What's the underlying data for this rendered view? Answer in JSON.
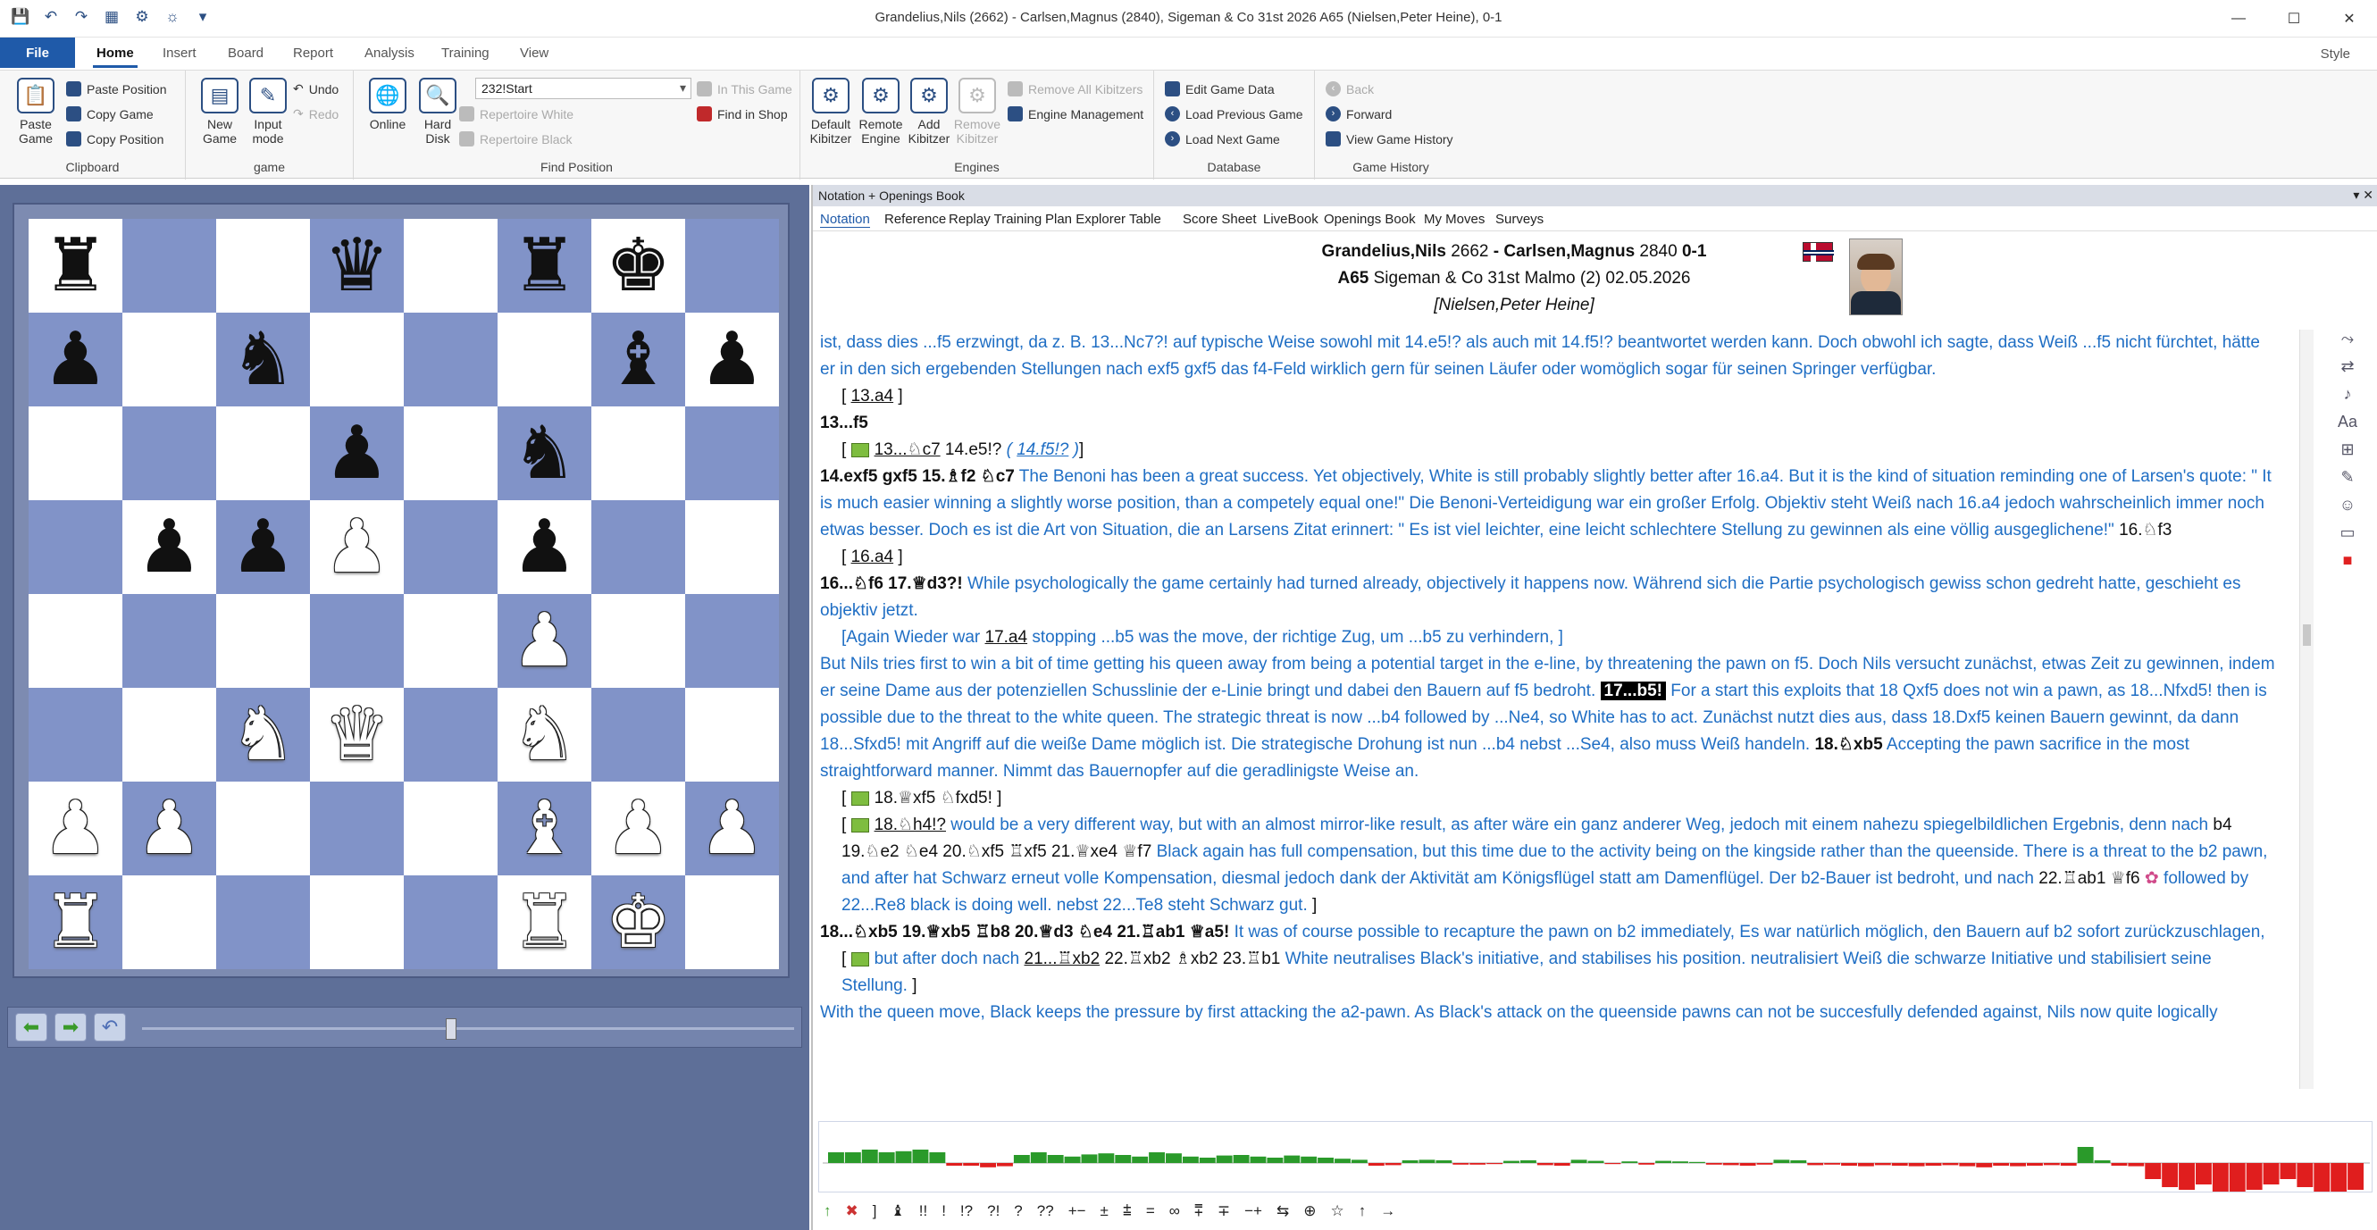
{
  "window": {
    "title": "Grandelius,Nils (2662) - Carlsen,Magnus (2840), Sigeman & Co 31st 2026  A65  (Nielsen,Peter Heine), 0-1",
    "minimize": "—",
    "maximize": "☐",
    "close": "✕"
  },
  "ribbon_tabs": {
    "file": "File",
    "home": "Home",
    "insert": "Insert",
    "board": "Board",
    "report": "Report",
    "analysis": "Analysis",
    "training": "Training",
    "view": "View",
    "style": "Style"
  },
  "ribbon": {
    "clipboard": {
      "label": "Clipboard",
      "paste_game": "Paste Game",
      "paste_position": "Paste Position",
      "copy_game": "Copy Game",
      "copy_position": "Copy Position"
    },
    "game": {
      "label": "game",
      "new_game": "New Game",
      "input_mode": "Input mode",
      "undo": "Undo",
      "redo": "Redo"
    },
    "find_position": {
      "label": "Find Position",
      "online": "Online",
      "hard_disk": "Hard Disk",
      "combo_value": "232!Start",
      "repertoire_white": "Repertoire White",
      "repertoire_black": "Repertoire Black",
      "in_this_game": "In This Game",
      "find_in_shop": "Find in Shop"
    },
    "engines": {
      "label": "Engines",
      "default_kibitzer": "Default Kibitzer",
      "remote_engine": "Remote Engine",
      "add_kibitzer": "Add Kibitzer",
      "remove_kibitzer": "Remove Kibitzer",
      "remove_all": "Remove All Kibitzers",
      "engine_management": "Engine Management"
    },
    "database": {
      "label": "Database",
      "edit_game_data": "Edit Game Data",
      "load_previous": "Load Previous Game",
      "load_next": "Load Next Game"
    },
    "history": {
      "label": "Game History",
      "back": "Back",
      "forward": "Forward",
      "view_history": "View Game History"
    }
  },
  "board": {
    "ranks": [
      [
        "r",
        "",
        "",
        "q",
        "",
        "r",
        "k",
        ""
      ],
      [
        "p",
        "",
        "n",
        "",
        "",
        "",
        "b",
        "p"
      ],
      [
        "",
        "",
        "",
        "p",
        "",
        "n",
        "",
        ""
      ],
      [
        "",
        "p",
        "p",
        "P",
        "",
        "p",
        "",
        ""
      ],
      [
        "",
        "",
        "",
        "",
        "",
        "P",
        "",
        ""
      ],
      [
        "",
        "",
        "N",
        "Q",
        "",
        "N",
        "",
        ""
      ],
      [
        "P",
        "P",
        "",
        "",
        "",
        "B",
        "P",
        "P"
      ],
      [
        "R",
        "",
        "",
        "",
        "",
        "R",
        "K",
        ""
      ]
    ]
  },
  "notation": {
    "pane_title": "Notation + Openings Book",
    "tabs": [
      "Notation",
      "Reference",
      "Replay Training",
      "Plan Explorer",
      "Table",
      "Score Sheet",
      "LiveBook",
      "Openings Book",
      "My Moves",
      "Surveys"
    ],
    "header": {
      "white": "Grandelius,Nils",
      "white_elo": "2662",
      "black": "Carlsen,Magnus",
      "black_elo": "2840",
      "result": "0-1",
      "eco": "A65",
      "event": "Sigeman & Co 31st Malmo (2)",
      "date": "02.05.2026",
      "annotator": "[Nielsen,Peter Heine]"
    }
  },
  "text": {
    "p1": "ist, dass dies ...f5 erzwingt, da z. B. 13...Nc7?! auf typische Weise sowohl mit 14.e5!? als auch mit 14.f5!? beantwortet werden kann. Doch obwohl ich sagte, dass Weiß ...f5 nicht fürchtet, hätte er in den sich ergebenden Stellungen nach exf5 gxf5 das f4-Feld wirklich gern für seinen Läufer oder womöglich sogar für seinen Springer verfügbar.",
    "p2": "13.a4",
    "p3": "13...f5",
    "p4a": "13...♘c7",
    "p4b": "14.e5!?",
    "p4c": "14.f5!?",
    "p5a": "14.exf5  gxf5  15.♗f2  ♘c7",
    "p5b": "The Benoni has been a great success. Yet objectively, White is still probably slightly better after 16.a4. But it is the kind of situation reminding one of Larsen's quote: \" It is much easier winning a slightly worse position, than a competely equal one!\" Die Benoni-Verteidigung war ein großer Erfolg. Objektiv steht Weiß nach 16.a4 jedoch wahrscheinlich immer noch etwas besser. Doch es ist die Art von Situation, die an Larsens Zitat erinnert: \" Es ist viel leichter, eine leicht schlechtere Stellung zu gewinnen als eine völlig ausgeglichene!\"",
    "p5c": "16.♘f3",
    "p6": "16.a4",
    "p7a": "16...♘f6  17.♕d3?!",
    "p7b": "While psychologically the game certainly had turned already, objectively it happens now. Während sich die Partie psychologisch gewiss schon gedreht hatte, geschieht es objektiv jetzt.",
    "p8a": "Again Wieder war",
    "p8b": "17.a4",
    "p8c": "stopping ...b5 was the move, der richtige Zug, um ...b5 zu verhindern,",
    "p9a": "But Nils tries first to win a bit of time getting his queen away from being a potential target in the e-line, by threatening the pawn on f5.  Doch Nils versucht zunächst, etwas Zeit zu gewinnen, indem er seine Dame aus der potenziellen Schusslinie der e-Linie bringt und dabei den Bauern auf f5 bedroht.",
    "p9b": "17...b5!",
    "p9c": "For a start this exploits that 18 Qxf5 does not win a pawn, as 18...Nfxd5! then is possible due to the threat to the white queen. The strategic threat is now ...b4 followed by ...Ne4, so White has to act. Zunächst nutzt dies aus, dass 18.Dxf5 keinen Bauern gewinnt, da dann 18...Sfxd5! mit Angriff auf die weiße Dame möglich ist. Die strategische Drohung ist nun ...b4 nebst ...Se4, also muss Weiß handeln.",
    "p9d": "18.♘xb5",
    "p9e": "Accepting the pawn sacrifice in the most straightforward manner. Nimmt das Bauernopfer auf die geradlinigste Weise an.",
    "p10": "18.♕xf5  ♘fxd5!",
    "p11a": "18.♘h4!?",
    "p11b": "would be a very different way, but with an almost mirror-like result, as after wäre ein ganz anderer Weg, jedoch mit einem nahezu spiegelbildlichen Ergebnis, denn nach",
    "p11c": "b4  19.♘e2  ♘e4  20.♘xf5  ♖xf5  21.♕xe4  ♕f7",
    "p11d": "Black again has full compensation, but this time due to the activity being on the kingside rather than the queenside. There is a threat to the b2 pawn, and after hat Schwarz erneut volle Kompensation, diesmal jedoch dank der Aktivität am Königsflügel statt am Damenflügel. Der b2-Bauer ist bedroht, und nach",
    "p11e": "22.♖ab1 ♕f6",
    "p11f": "followed by 22...Re8 black is doing well. nebst 22...Te8 steht Schwarz gut.",
    "p12a": "18...♘xb5  19.♕xb5  ♖b8  20.♕d3  ♘e4  21.♖ab1  ♕a5!",
    "p12b": "It was of course possible to recapture the pawn on b2 immediately, Es war natürlich möglich, den Bauern auf b2 sofort zurückzuschlagen,",
    "p13a": "but after doch nach",
    "p13b": "21...♖xb2",
    "p13c": "22.♖xb2  ♗xb2  23.♖b1",
    "p13d": "White neutralises Black's initiative, and stabilises his position. neutralisiert Weiß die schwarze Initiative und stabilisiert seine Stellung.",
    "p14": "With the queen move, Black keeps the pressure by first attacking the a2-pawn. As Black's attack on the queenside pawns can not be succesfully defended against, Nils now quite logically"
  },
  "graph": {
    "evals": [
      0.2,
      0.2,
      0.25,
      0.2,
      0.22,
      0.25,
      0.2,
      -0.05,
      -0.05,
      -0.08,
      -0.06,
      0.15,
      0.2,
      0.15,
      0.12,
      0.16,
      0.18,
      0.15,
      0.12,
      0.2,
      0.18,
      0.12,
      0.1,
      0.14,
      0.15,
      0.12,
      0.1,
      0.14,
      0.12,
      0.1,
      0.08,
      0.06,
      -0.05,
      -0.04,
      0.05,
      0.06,
      0.05,
      -0.03,
      -0.03,
      -0.02,
      0.04,
      0.05,
      -0.04,
      -0.05,
      0.06,
      0.04,
      -0.02,
      0.03,
      -0.03,
      0.04,
      0.03,
      0.02,
      -0.03,
      -0.04,
      -0.05,
      -0.03,
      0.06,
      0.05,
      -0.04,
      -0.03,
      -0.05,
      -0.06,
      -0.04,
      -0.05,
      -0.06,
      -0.05,
      -0.04,
      -0.06,
      -0.08,
      -0.05,
      -0.06,
      -0.05,
      -0.04,
      -0.05,
      0.3,
      0.05,
      -0.05,
      -0.06,
      -0.3,
      -0.45,
      -0.5,
      -0.4,
      -0.55,
      -0.6,
      -0.5,
      -0.4,
      -0.3,
      -0.45,
      -0.55,
      -0.6,
      -0.5
    ]
  },
  "toolbar": {
    "symbols": [
      "!!",
      "!",
      "!?",
      "?!",
      "?",
      "??",
      "+−",
      "±",
      "⩲",
      "=",
      "∞",
      "⩱",
      "∓",
      "−+",
      "⇆",
      "⊕",
      "☆",
      "↑",
      "→"
    ]
  },
  "colors": {
    "accent": "#1f5aa9",
    "light_square": "#ffffff",
    "dark_square": "#8193c8",
    "comment": "#1f6ec4"
  }
}
